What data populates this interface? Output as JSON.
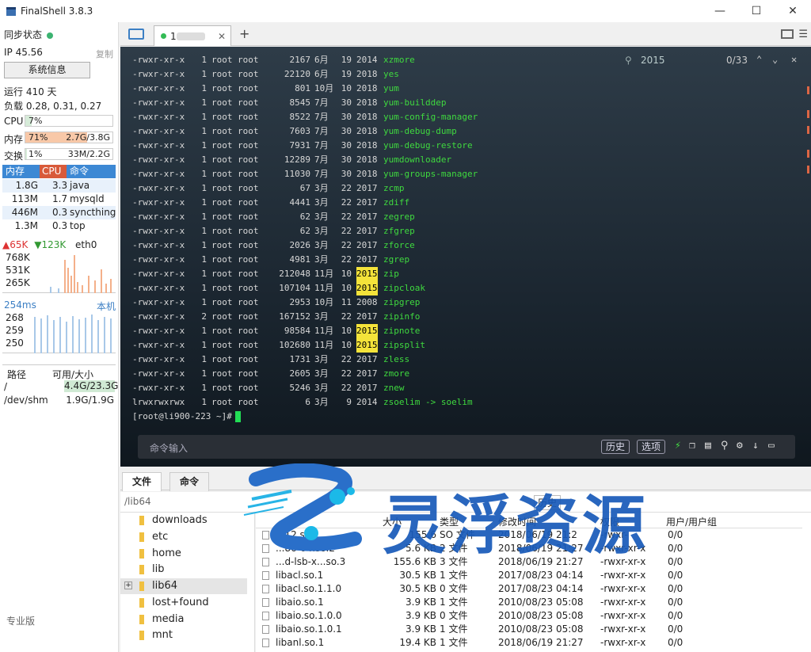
{
  "window": {
    "title": "FinalShell 3.8.3",
    "controls": [
      "—",
      "☐",
      "✕"
    ]
  },
  "sidebar": {
    "sync_label": "同步状态",
    "ip_label": "IP 45.56",
    "copy_label": "复制",
    "sysinfo_button": "系统信息",
    "uptime": "运行 410 天",
    "load": "负载 0.28, 0.31, 0.27",
    "cpu": {
      "label": "CPU",
      "percent": "7%",
      "fill": 0.07
    },
    "mem": {
      "label": "内存",
      "percent": "71%",
      "used": "2.7G/3.8G",
      "fill": 0.71
    },
    "swap": {
      "label": "交换",
      "percent": "1%",
      "used": "33M/2.2G",
      "fill": 0.01
    },
    "proc_headers": [
      "内存",
      "CPU",
      "命令"
    ],
    "processes": [
      {
        "mem": "1.8G",
        "cpu": "3.3",
        "cmd": "java"
      },
      {
        "mem": "113M",
        "cpu": "1.7",
        "cmd": "mysqld"
      },
      {
        "mem": "446M",
        "cpu": "0.3",
        "cmd": "syncthing"
      },
      {
        "mem": "1.3M",
        "cpu": "0.3",
        "cmd": "top"
      }
    ],
    "net": {
      "up": "65K",
      "down": "123K",
      "iface": "eth0",
      "ticks": [
        "768K",
        "531K",
        "265K"
      ]
    },
    "ping": {
      "latency": "254ms",
      "host": "本机",
      "ticks": [
        "268",
        "259",
        "250"
      ]
    },
    "disk_headers": [
      "路径",
      "可用/大小"
    ],
    "disks": [
      {
        "path": "/",
        "size": "4.4G/23.3G"
      },
      {
        "path": "/dev/shm",
        "size": "1.9G/1.9G"
      }
    ],
    "edition": "专业版"
  },
  "tabs": {
    "session_label": "1 ",
    "close": "✕",
    "add": "+"
  },
  "terminal": {
    "find": {
      "term": "2015",
      "count": "0/33"
    },
    "lines": [
      [
        "-rwxr-xr-x",
        "1",
        "root",
        "root",
        "2167",
        "6月",
        "19",
        "2014",
        "xzmore"
      ],
      [
        "-rwxr-xr-x",
        "1",
        "root",
        "root",
        "22120",
        "6月",
        "19",
        "2018",
        "yes"
      ],
      [
        "-rwxr-xr-x",
        "1",
        "root",
        "root",
        "801",
        "10月",
        "10",
        "2018",
        "yum"
      ],
      [
        "-rwxr-xr-x",
        "1",
        "root",
        "root",
        "8545",
        "7月",
        "30",
        "2018",
        "yum-builddep"
      ],
      [
        "-rwxr-xr-x",
        "1",
        "root",
        "root",
        "8522",
        "7月",
        "30",
        "2018",
        "yum-config-manager"
      ],
      [
        "-rwxr-xr-x",
        "1",
        "root",
        "root",
        "7603",
        "7月",
        "30",
        "2018",
        "yum-debug-dump"
      ],
      [
        "-rwxr-xr-x",
        "1",
        "root",
        "root",
        "7931",
        "7月",
        "30",
        "2018",
        "yum-debug-restore"
      ],
      [
        "-rwxr-xr-x",
        "1",
        "root",
        "root",
        "12289",
        "7月",
        "30",
        "2018",
        "yumdownloader"
      ],
      [
        "-rwxr-xr-x",
        "1",
        "root",
        "root",
        "11030",
        "7月",
        "30",
        "2018",
        "yum-groups-manager"
      ],
      [
        "-rwxr-xr-x",
        "1",
        "root",
        "root",
        "67",
        "3月",
        "22",
        "2017",
        "zcmp"
      ],
      [
        "-rwxr-xr-x",
        "1",
        "root",
        "root",
        "4441",
        "3月",
        "22",
        "2017",
        "zdiff"
      ],
      [
        "-rwxr-xr-x",
        "1",
        "root",
        "root",
        "62",
        "3月",
        "22",
        "2017",
        "zegrep"
      ],
      [
        "-rwxr-xr-x",
        "1",
        "root",
        "root",
        "62",
        "3月",
        "22",
        "2017",
        "zfgrep"
      ],
      [
        "-rwxr-xr-x",
        "1",
        "root",
        "root",
        "2026",
        "3月",
        "22",
        "2017",
        "zforce"
      ],
      [
        "-rwxr-xr-x",
        "1",
        "root",
        "root",
        "4981",
        "3月",
        "22",
        "2017",
        "zgrep"
      ],
      [
        "-rwxr-xr-x",
        "1",
        "root",
        "root",
        "212048",
        "11月",
        "10",
        "2015",
        "zip"
      ],
      [
        "-rwxr-xr-x",
        "1",
        "root",
        "root",
        "107104",
        "11月",
        "10",
        "2015",
        "zipcloak"
      ],
      [
        "-rwxr-xr-x",
        "1",
        "root",
        "root",
        "2953",
        "10月",
        "11",
        "2008",
        "zipgrep"
      ],
      [
        "-rwxr-xr-x",
        "2",
        "root",
        "root",
        "167152",
        "3月",
        "22",
        "2017",
        "zipinfo"
      ],
      [
        "-rwxr-xr-x",
        "1",
        "root",
        "root",
        "98584",
        "11月",
        "10",
        "2015",
        "zipnote"
      ],
      [
        "-rwxr-xr-x",
        "1",
        "root",
        "root",
        "102680",
        "11月",
        "10",
        "2015",
        "zipsplit"
      ],
      [
        "-rwxr-xr-x",
        "1",
        "root",
        "root",
        "1731",
        "3月",
        "22",
        "2017",
        "zless"
      ],
      [
        "-rwxr-xr-x",
        "1",
        "root",
        "root",
        "2605",
        "3月",
        "22",
        "2017",
        "zmore"
      ],
      [
        "-rwxr-xr-x",
        "1",
        "root",
        "root",
        "5246",
        "3月",
        "22",
        "2017",
        "znew"
      ],
      [
        "lrwxrwxrwx",
        "1",
        "root",
        "root",
        "6",
        "3月",
        "9",
        "2014",
        "zsoelim -> soelim"
      ]
    ],
    "prompt": "[root@li900-223 ~]#",
    "highlight_year": "2015"
  },
  "cmdbar": {
    "placeholder": "命令输入",
    "history": "历史",
    "options": "选项"
  },
  "bottom": {
    "tabs": [
      "文件",
      "命令"
    ],
    "path": "/lib64",
    "history_btn": "历史",
    "tree": [
      "downloads",
      "etc",
      "home",
      "lib",
      "lib64",
      "lost+found",
      "media",
      "mnt"
    ],
    "file_headers": [
      "大小",
      "类型",
      "修改时间",
      "权限",
      "用户/用户组"
    ],
    "files": [
      {
        "name": "...12.so",
        "size": "155.6",
        "type": "SO 文件",
        "time": "2018/06/19 21:2",
        "perm": "-rwxr-",
        "owner": "0/0"
      },
      {
        "name": "...86-64.so.2",
        "size": "5.6 KB",
        "type": "2 文件",
        "time": "2018/06/19 21:27",
        "perm": "-rwxr-xr-x",
        "owner": "0/0"
      },
      {
        "name": "...d-lsb-x...so.3",
        "size": "155.6 KB",
        "type": "3 文件",
        "time": "2018/06/19 21:27",
        "perm": "-rwxr-xr-x",
        "owner": "0/0"
      },
      {
        "name": "libacl.so.1",
        "size": "30.5 KB",
        "type": "1 文件",
        "time": "2017/08/23 04:14",
        "perm": "-rwxr-xr-x",
        "owner": "0/0"
      },
      {
        "name": "libacl.so.1.1.0",
        "size": "30.5 KB",
        "type": "0 文件",
        "time": "2017/08/23 04:14",
        "perm": "-rwxr-xr-x",
        "owner": "0/0"
      },
      {
        "name": "libaio.so.1",
        "size": "3.9 KB",
        "type": "1 文件",
        "time": "2010/08/23 05:08",
        "perm": "-rwxr-xr-x",
        "owner": "0/0"
      },
      {
        "name": "libaio.so.1.0.0",
        "size": "3.9 KB",
        "type": "0 文件",
        "time": "2010/08/23 05:08",
        "perm": "-rwxr-xr-x",
        "owner": "0/0"
      },
      {
        "name": "libaio.so.1.0.1",
        "size": "3.9 KB",
        "type": "1 文件",
        "time": "2010/08/23 05:08",
        "perm": "-rwxr-xr-x",
        "owner": "0/0"
      },
      {
        "name": "libanl.so.1",
        "size": "19.4 KB",
        "type": "1 文件",
        "time": "2018/06/19 21:27",
        "perm": "-rwxr-xr-x",
        "owner": "0/0"
      }
    ]
  },
  "watermark": {
    "text": "灵浮资源"
  },
  "colors": {
    "accent": "#3c88d4",
    "file_green": "#3fd93f",
    "highlight": "#f4e33a",
    "cpu_bar": "#d7ecd9",
    "mem_bar": "#f8c8a8"
  }
}
